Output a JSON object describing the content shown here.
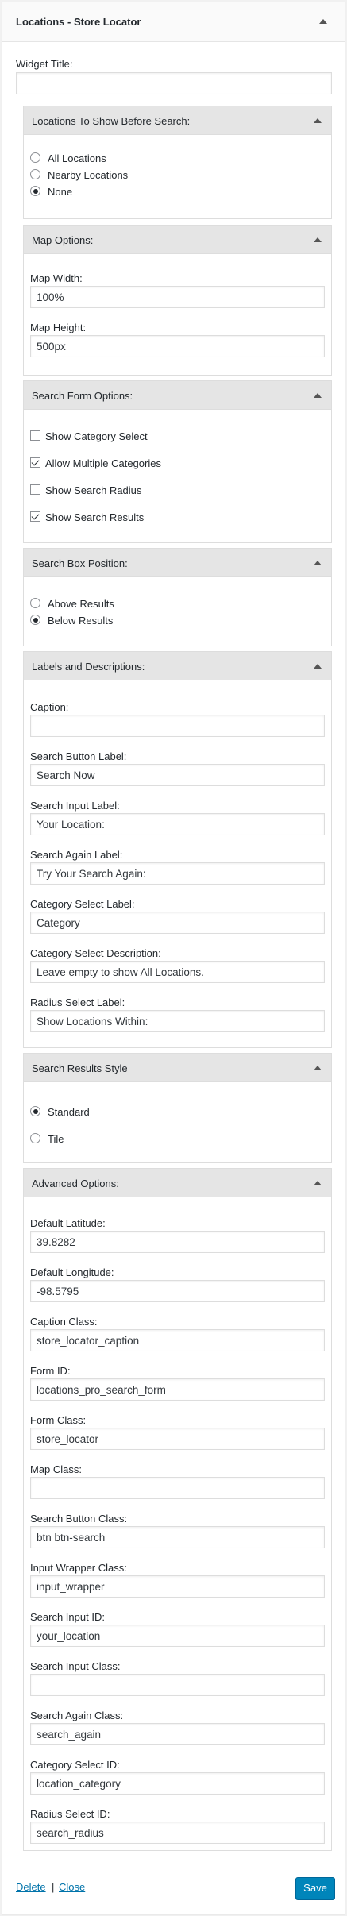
{
  "widget": {
    "title": "Locations - Store Locator"
  },
  "widget_title": {
    "label": "Widget Title:",
    "value": ""
  },
  "locations_section": {
    "title": "Locations To Show Before Search:",
    "options": [
      "All Locations",
      "Nearby Locations",
      "None"
    ],
    "selected": "None"
  },
  "map_section": {
    "title": "Map Options:",
    "width_label": "Map Width:",
    "width_value": "100%",
    "height_label": "Map Height:",
    "height_value": "500px"
  },
  "search_form_section": {
    "title": "Search Form Options:",
    "options": [
      {
        "label": "Show Category Select",
        "checked": false
      },
      {
        "label": "Allow Multiple Categories",
        "checked": true
      },
      {
        "label": "Show Search Radius",
        "checked": false
      },
      {
        "label": "Show Search Results",
        "checked": true
      }
    ]
  },
  "search_box_section": {
    "title": "Search Box Position:",
    "options": [
      "Above Results",
      "Below Results"
    ],
    "selected": "Below Results"
  },
  "labels_section": {
    "title": "Labels and Descriptions:",
    "fields": [
      {
        "label": "Caption:",
        "value": ""
      },
      {
        "label": "Search Button Label:",
        "value": "Search Now"
      },
      {
        "label": "Search Input Label:",
        "value": "Your Location:"
      },
      {
        "label": "Search Again Label:",
        "value": "Try Your Search Again:"
      },
      {
        "label": "Category Select Label:",
        "value": "Category"
      },
      {
        "label": "Category Select Description:",
        "value": "Leave empty to show All Locations."
      },
      {
        "label": "Radius Select Label:",
        "value": "Show Locations Within:"
      }
    ]
  },
  "results_style_section": {
    "title": "Search Results Style",
    "options": [
      "Standard",
      "Tile"
    ],
    "selected": "Standard"
  },
  "advanced_section": {
    "title": "Advanced Options:",
    "fields": [
      {
        "label": "Default Latitude:",
        "value": "39.8282"
      },
      {
        "label": "Default Longitude:",
        "value": "-98.5795"
      },
      {
        "label": "Caption Class:",
        "value": "store_locator_caption"
      },
      {
        "label": "Form ID:",
        "value": "locations_pro_search_form"
      },
      {
        "label": "Form Class:",
        "value": "store_locator"
      },
      {
        "label": "Map Class:",
        "value": ""
      },
      {
        "label": "Search Button Class:",
        "value": "btn btn-search"
      },
      {
        "label": "Input Wrapper Class:",
        "value": "input_wrapper"
      },
      {
        "label": "Search Input ID:",
        "value": "your_location"
      },
      {
        "label": "Search Input Class:",
        "value": ""
      },
      {
        "label": "Search Again Class:",
        "value": "search_again"
      },
      {
        "label": "Category Select ID:",
        "value": "location_category"
      },
      {
        "label": "Radius Select ID:",
        "value": "search_radius"
      }
    ]
  },
  "footer": {
    "delete_label": "Delete",
    "separator": "|",
    "close_label": "Close",
    "save_label": "Save"
  },
  "colors": {
    "accent": "#0085ba",
    "link": "#0073aa",
    "section_header": "#e5e5e5"
  },
  "icons": {
    "section_toggle": "triangle-up-icon"
  }
}
